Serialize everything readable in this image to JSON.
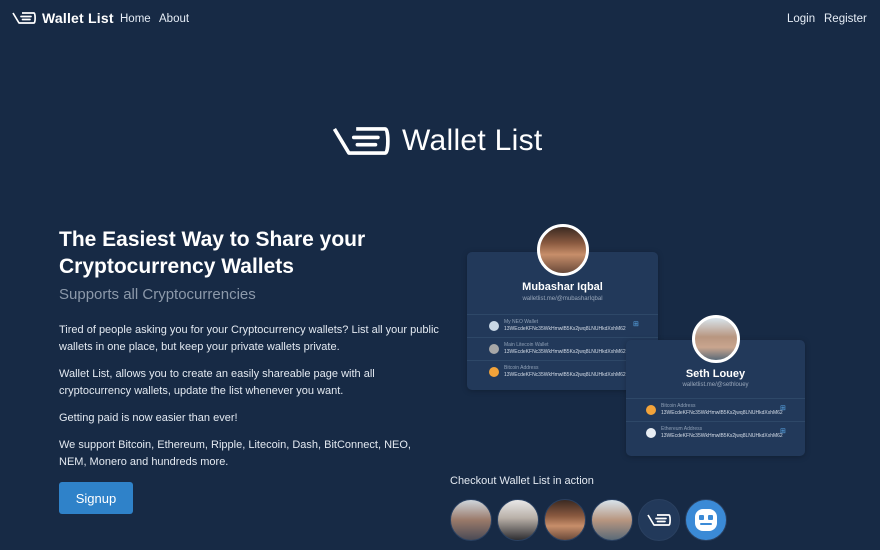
{
  "nav": {
    "brand": "Wallet List",
    "links": {
      "home": "Home",
      "about": "About",
      "login": "Login",
      "register": "Register"
    }
  },
  "hero": {
    "logo_text": "Wallet List"
  },
  "content": {
    "headline": "The Easiest Way to Share your Cryptocurrency Wallets",
    "subheadline": "Supports all Cryptocurrencies",
    "paragraphs": [
      "Tired of people asking you for your Cryptocurrency wallets? List all your public wallets in one place, but keep your private wallets private.",
      "Wallet List, allows you to create an easily shareable page with all cryptocurrency wallets, update the list whenever you want.",
      "Getting paid is now easier than ever!",
      "We support Bitcoin, Ethereum, Ripple, Litecoin, Dash, BitConnect, NEO, NEM, Monero and hundreds more."
    ],
    "signup_label": "Signup"
  },
  "cards": [
    {
      "name": "Mubashar Iqbal",
      "url": "walletlist.me/@mubasharIqbal",
      "wallets": [
        {
          "name": "My NEO Wallet",
          "address": "13WEcdeKFNc35WkHmwlB5Ks2jwq8LNUHkdXxhM62",
          "coin_color": "#c9d8e6"
        },
        {
          "name": "Main Litecoin Wallet",
          "address": "13WEcdeKFNc35WkHmwlB5Ks2jwq8LNUHkdXxhM62",
          "coin_color": "#a7a7a7"
        },
        {
          "name": "Bitcoin Address",
          "address": "13WEcdeKFNc35WkHmwlB5Ks2jwq8LNUHkdXxhM62",
          "coin_color": "#f2a33a"
        }
      ]
    },
    {
      "name": "Seth Louey",
      "url": "walletlist.me/@sethlouey",
      "wallets": [
        {
          "name": "Bitcoin Address",
          "address": "13WEcdeKFNc35WkHmwlB5Ks2jwq8LNUHkdXxhM62",
          "coin_color": "#f2a33a"
        },
        {
          "name": "Ethereum Address",
          "address": "13WEcdeKFNc35WkHmwlB5Ks2jwq8LNUHkdXxhM62",
          "coin_color": "#e8edf3"
        }
      ]
    }
  ],
  "showcase": {
    "title": "Checkout Wallet List in action"
  },
  "colors": {
    "background": "#172a45",
    "card": "#22395a",
    "accent": "#2f82c9",
    "muted": "#8c99aa"
  }
}
